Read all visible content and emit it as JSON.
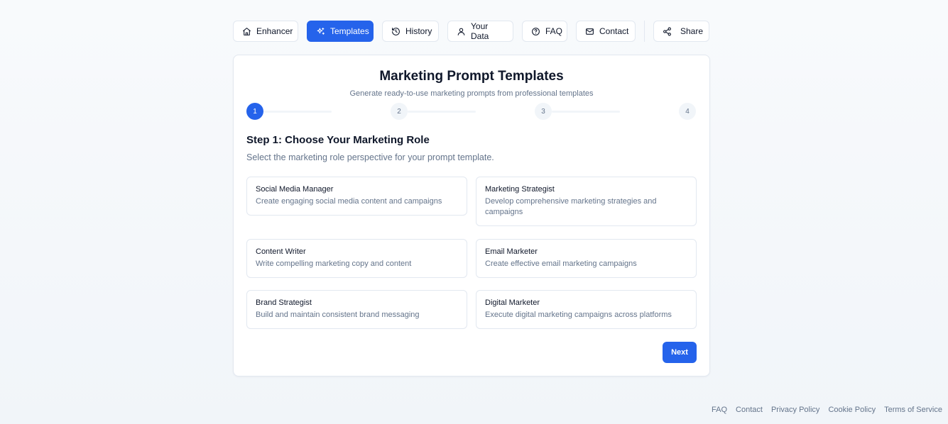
{
  "nav": {
    "items": [
      {
        "label": "Enhancer",
        "icon": "home-icon"
      },
      {
        "label": "Templates",
        "icon": "sparkles-icon",
        "active": true
      },
      {
        "label": "History",
        "icon": "history-icon"
      },
      {
        "label": "Your Data",
        "icon": "user-icon"
      },
      {
        "label": "FAQ",
        "icon": "help-circle-icon"
      },
      {
        "label": "Contact",
        "icon": "mail-icon"
      }
    ],
    "share_label": "Share"
  },
  "card": {
    "title": "Marketing Prompt Templates",
    "subtitle": "Generate ready-to-use marketing prompts from professional templates",
    "steps": [
      "1",
      "2",
      "3",
      "4"
    ],
    "current_step": 1,
    "step_heading": "Step 1: Choose Your Marketing Role",
    "step_description": "Select the marketing role perspective for your prompt template.",
    "roles": [
      {
        "title": "Social Media Manager",
        "description": "Create engaging social media content and campaigns"
      },
      {
        "title": "Marketing Strategist",
        "description": "Develop comprehensive marketing strategies and campaigns"
      },
      {
        "title": "Content Writer",
        "description": "Write compelling marketing copy and content"
      },
      {
        "title": "Email Marketer",
        "description": "Create effective email marketing campaigns"
      },
      {
        "title": "Brand Strategist",
        "description": "Build and maintain consistent brand messaging"
      },
      {
        "title": "Digital Marketer",
        "description": "Execute digital marketing campaigns across platforms"
      }
    ],
    "next_label": "Next"
  },
  "footer": {
    "links": [
      "FAQ",
      "Contact",
      "Privacy Policy",
      "Cookie Policy",
      "Terms of Service"
    ]
  },
  "colors": {
    "accent": "#2563eb",
    "border": "#e2e8f0",
    "muted_text": "#64748b",
    "text": "#0f172a"
  }
}
